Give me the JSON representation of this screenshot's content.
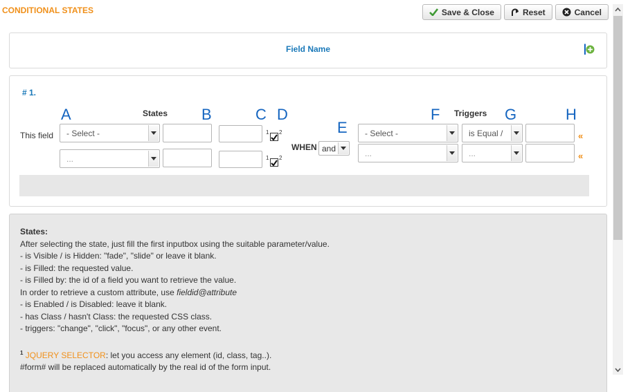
{
  "header": {
    "title": "CONDITIONAL STATES",
    "save_close": "Save & Close",
    "reset": "Reset",
    "cancel": "Cancel"
  },
  "field_panel": {
    "field_name": "Field Name",
    "marker": "I"
  },
  "rule": {
    "number": "# 1.",
    "states_header": "States",
    "triggers_header": "Triggers",
    "this_field": "This field",
    "when": "WHEN",
    "markers": {
      "a": "A",
      "b": "B",
      "c": "C",
      "d": "D",
      "e": "E",
      "f": "F",
      "g": "G",
      "h": "H"
    },
    "rows": [
      {
        "state_select": "- Select -",
        "trigger_select": "- Select -",
        "operator": "is Equal /"
      },
      {
        "state_select": "...",
        "trigger_select": "...",
        "operator": "..."
      }
    ],
    "conjunction": "and",
    "sup1": "1",
    "sup2": "2",
    "quote": "«"
  },
  "help": {
    "title": "States:",
    "lines": [
      "After selecting the state, just fill the first inputbox using the suitable parameter/value.",
      "- is Visible / is Hidden: \"fade\", \"slide\" or leave it blank.",
      "- is Filled: the requested value.",
      "- is Filled by: the id of a field you want to retrieve the value.",
      "In order to retrieve a custom attribute, use ",
      "fieldid@attribute",
      "- is Enabled / is Disabled: leave it blank.",
      "- has Class / hasn't Class: the requested CSS class.",
      "- triggers: \"change\", \"click\", \"focus\", or any other event."
    ],
    "footnote_num": "1",
    "jquery_label": "JQUERY SELECTOR",
    "jquery_text": ": let you access any element (id, class, tag..).",
    "form_line": "#form# will be replaced automatically by the real id of the form input."
  },
  "colors": {
    "accent_orange": "#f0901a",
    "link_blue": "#1a79b9",
    "marker_blue": "#1565c0"
  }
}
